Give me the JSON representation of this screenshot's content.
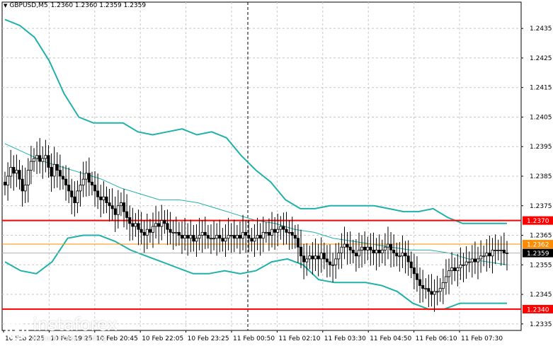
{
  "header": {
    "symbol_timeframe": "GBPUSD,M5",
    "ohlc": "1.2360 1.2360 1.2359 1.2359"
  },
  "watermark": {
    "brand": "instaforex",
    "tagline": "Instant Forex Trading"
  },
  "chart_data": {
    "type": "candlestick",
    "symbol": "GBPUSD",
    "timeframe": "M5",
    "ylim": [
      1.23328,
      1.24439
    ],
    "y_ticks": [
      "1.2435",
      "1.2425",
      "1.2415",
      "1.2405",
      "1.2395",
      "1.2385",
      "1.2375",
      "1.2365",
      "1.2355",
      "1.2345",
      "1.2335"
    ],
    "x_ticks": [
      "10 Feb 2025",
      "10 Feb 19:25",
      "10 Feb 20:45",
      "10 Feb 22:05",
      "10 Feb 23:25",
      "11 Feb 00:50",
      "11 Feb 02:10",
      "11 Feb 03:30",
      "11 Feb 04:50",
      "11 Feb 06:10",
      "11 Feb 07:30"
    ],
    "levels": [
      {
        "price": 1.237,
        "label": "1.2370",
        "color": "#ff0000"
      },
      {
        "price": 1.2362,
        "label": "1.2362",
        "color": "#ff8c00"
      },
      {
        "price": 1.234,
        "label": "1.2340",
        "color": "#ff0000"
      }
    ],
    "current_price": {
      "price": 1.2359,
      "label": "1.2359",
      "color": "#000000"
    },
    "colors": {
      "candle": "#000000",
      "bands": "#20b2aa",
      "levels": "#ff0000",
      "grid": "#c8c8c8"
    },
    "grid": true,
    "candles_close": [
      1.2382,
      1.2385,
      1.2388,
      1.2386,
      1.2387,
      1.2384,
      1.238,
      1.2382,
      1.2387,
      1.239,
      1.2391,
      1.2392,
      1.239,
      1.2391,
      1.2392,
      1.2388,
      1.2385,
      1.2389,
      1.2387,
      1.2385,
      1.2384,
      1.2382,
      1.238,
      1.2378,
      1.2376,
      1.238,
      1.2382,
      1.2384,
      1.2386,
      1.2383,
      1.2382,
      1.238,
      1.2378,
      1.2377,
      1.2378,
      1.2376,
      1.2375,
      1.2374,
      1.2372,
      1.2375,
      1.2376,
      1.2373,
      1.2371,
      1.2369,
      1.2368,
      1.2369,
      1.2367,
      1.2366,
      1.2365,
      1.2367,
      1.2366,
      1.2368,
      1.2369,
      1.2368,
      1.237,
      1.2369,
      1.2367,
      1.2366,
      1.2366,
      1.2366,
      1.2365,
      1.2364,
      1.2365,
      1.2364,
      1.2365,
      1.2363,
      1.2364,
      1.2365,
      1.2366,
      1.2365,
      1.2364,
      1.2364,
      1.2364,
      1.2365,
      1.2364,
      1.2363,
      1.2364,
      1.2365,
      1.2365,
      1.2364,
      1.2365,
      1.2364,
      1.2366,
      1.2365,
      1.2364,
      1.2363,
      1.2364,
      1.2365,
      1.2364,
      1.2366,
      1.2366,
      1.2365,
      1.2367,
      1.2366,
      1.2367,
      1.2368,
      1.2367,
      1.2366,
      1.2366,
      1.2365,
      1.2364,
      1.2361,
      1.2358,
      1.2356,
      1.2357,
      1.2358,
      1.2357,
      1.2358,
      1.2357,
      1.2359,
      1.2357,
      1.2356,
      1.2355,
      1.2355,
      1.2357,
      1.2359,
      1.2361,
      1.2362,
      1.2361,
      1.236,
      1.2359,
      1.2358,
      1.236,
      1.2361,
      1.236,
      1.2361,
      1.236,
      1.2359,
      1.236,
      1.2359,
      1.236,
      1.2361,
      1.2362,
      1.236,
      1.2359,
      1.2358,
      1.2358,
      1.2359,
      1.2358,
      1.2356,
      1.2354,
      1.2352,
      1.235,
      1.2348,
      1.2347,
      1.2347,
      1.2346,
      1.2345,
      1.2346,
      1.2346,
      1.2347,
      1.2349,
      1.2351,
      1.2353,
      1.2354,
      1.2353,
      1.2354,
      1.2355,
      1.2355,
      1.2356,
      1.2356,
      1.2357,
      1.2356,
      1.2357,
      1.2358,
      1.2358,
      1.2359,
      1.2358,
      1.236,
      1.236,
      1.236,
      1.236,
      1.2359,
      1.2359
    ]
  }
}
